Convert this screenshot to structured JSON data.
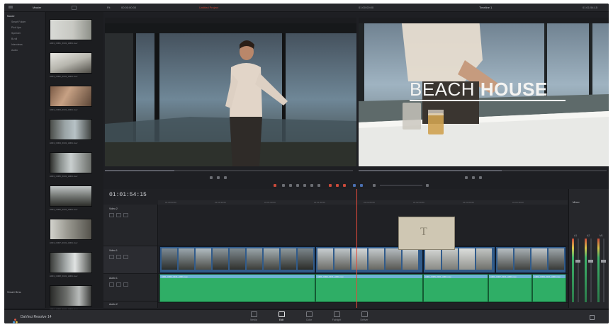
{
  "app": {
    "brand": "DaVinci Resolve 14",
    "project_name": "Untitled Project",
    "timeline_name": "Timeline 1",
    "record_timecode": "01:00:00:00",
    "source_timecode": "00:00:00:00",
    "zoom": "Fit"
  },
  "media_pool": {
    "bins": [
      "Master",
      "Smart Folder",
      "Pick Ups",
      "Speeder",
      "B-roll",
      "Interviews",
      "Audio"
    ],
    "smart_bins_label": "Smart Bins",
    "clips": [
      {
        "name": "A001_C001_0101_A001.mov"
      },
      {
        "name": "A001_C002_0101_A001.mov"
      },
      {
        "name": "A001_C003_0101_A001.mov"
      },
      {
        "name": "A001_C004_0101_A001.mov"
      },
      {
        "name": "A001_C005_0101_A001.mov"
      },
      {
        "name": "A001_C006_0101_A001.mov"
      },
      {
        "name": "A001_C007_0101_A001.mov"
      },
      {
        "name": "A001_C008_0101_A001.mov"
      },
      {
        "name": "A001_C009_0101_A001.mov"
      }
    ]
  },
  "viewers": {
    "record_overlay_title_light": "BEACH ",
    "record_overlay_title_bold": "HOUSE"
  },
  "timeline": {
    "timecode": "01:01:54:15",
    "ruler_ticks": [
      "01:00:00:00",
      "01:00:30:00",
      "01:01:00:00",
      "01:01:30:00",
      "01:02:00:00",
      "01:02:30:00",
      "01:03:00:00",
      "01:03:30:00"
    ],
    "tracks": [
      {
        "id": "V2",
        "name": "Video 2"
      },
      {
        "id": "V1",
        "name": "Video 1"
      },
      {
        "id": "A1",
        "name": "Audio 1"
      },
      {
        "id": "A2",
        "name": "Audio 2"
      }
    ],
    "title_clip_glyph": "T",
    "audio_clip_names": [
      "A001_C004_0101_A001.mov",
      "A001_C002_0101_A001.mov",
      "A001_C005_0101_A001.mov",
      "A001_C007_0101_A001.mov",
      "A001_C009_0101_A001.mov"
    ]
  },
  "mixer": {
    "label": "Mixer",
    "channels": [
      "A1",
      "A2",
      "M1"
    ]
  },
  "pages": [
    {
      "label": "Media"
    },
    {
      "label": "Edit"
    },
    {
      "label": "Color"
    },
    {
      "label": "Fairlight"
    },
    {
      "label": "Deliver"
    }
  ],
  "active_page": "Edit",
  "colors": {
    "accent_red": "#e24a3b",
    "video_clip": "#315b8a",
    "audio_clip": "#2fae66"
  }
}
